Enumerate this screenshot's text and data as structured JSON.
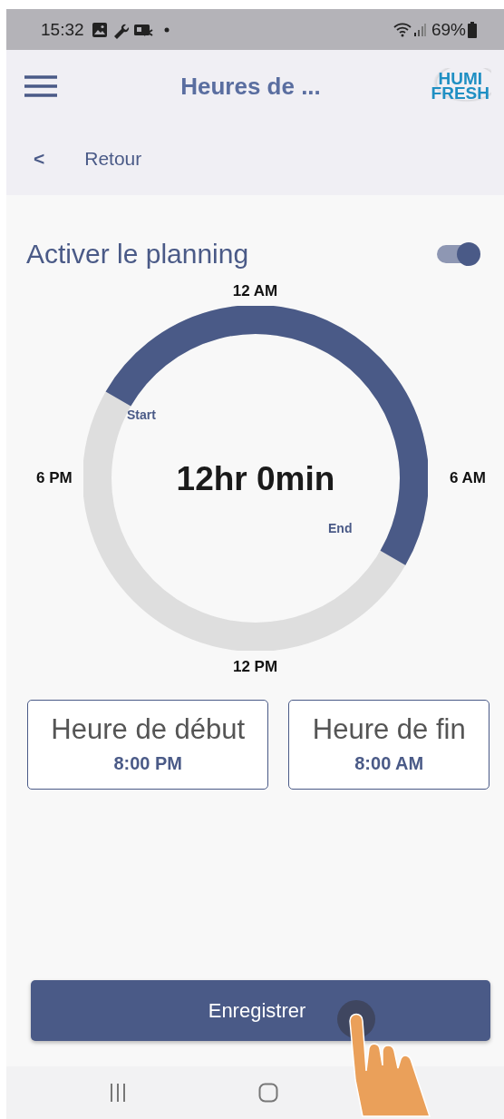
{
  "status_bar": {
    "time": "15:32",
    "battery": "69%"
  },
  "app_bar": {
    "title": "Heures de ...",
    "logo": {
      "line_1": "HUMI",
      "line_2": "FRESH"
    }
  },
  "back_link": {
    "icon": "<",
    "label": "Retour"
  },
  "schedule": {
    "title": "Activer le planning",
    "on": true
  },
  "dial": {
    "labels": {
      "top": "12 AM",
      "right": "6 AM",
      "bottom": "12 PM",
      "left": "6 PM"
    },
    "start_label": "Start",
    "end_label": "End",
    "duration": "12hr 0min",
    "level": 0.5
  },
  "time_cards": [
    {
      "label": "Heure de début",
      "value": "8:00 PM"
    },
    {
      "label": "Heure de fin",
      "value": "8:00 AM"
    }
  ],
  "save_button": {
    "label": "Enregistrer"
  }
}
